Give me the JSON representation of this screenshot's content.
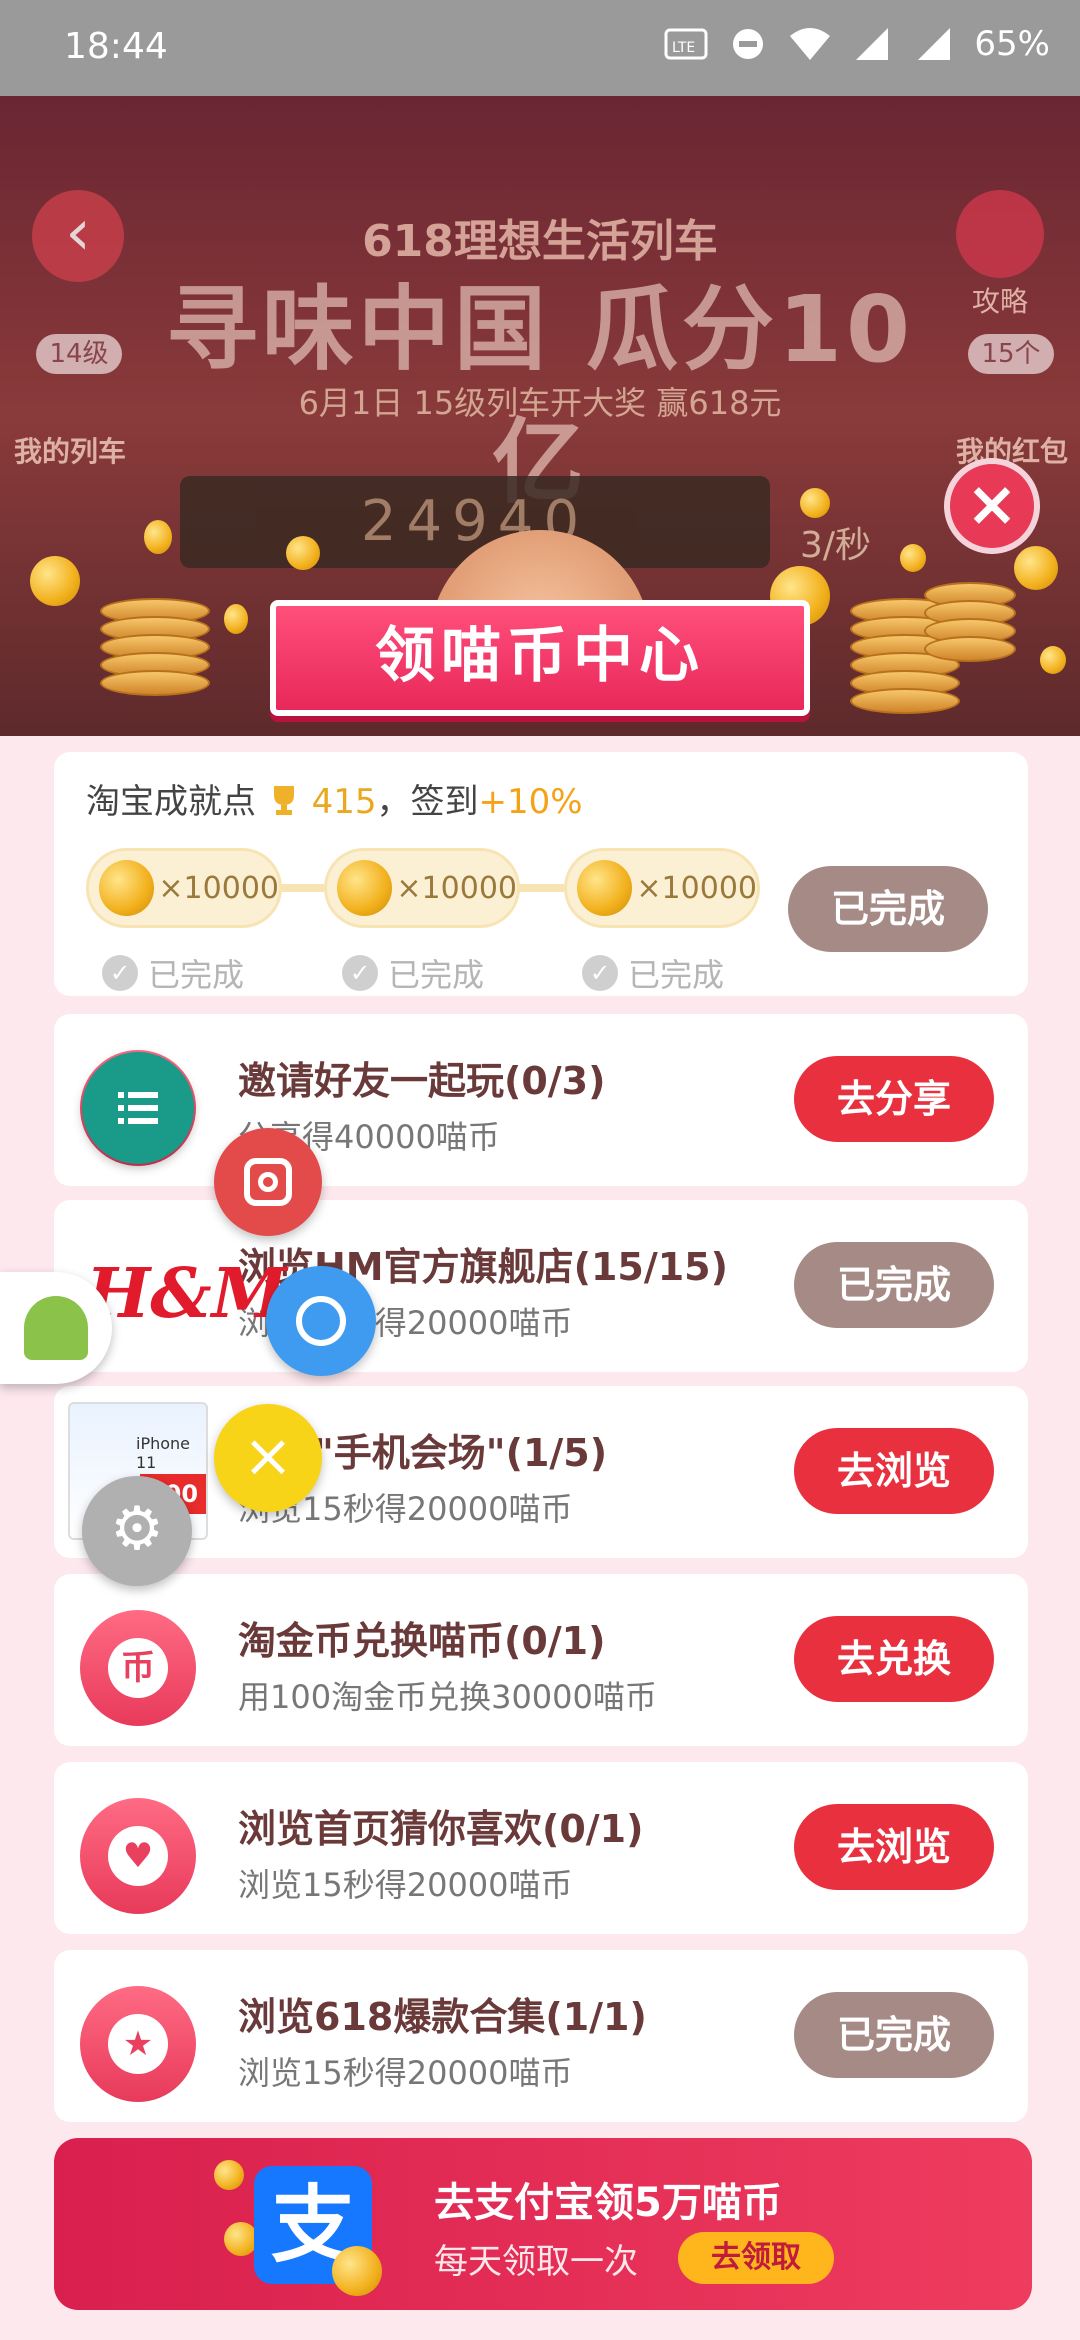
{
  "status_bar": {
    "time": "18:44",
    "battery": "65%",
    "icons": [
      "volte-icon",
      "dnd-icon",
      "wifi-icon",
      "signal-icon",
      "signal-icon"
    ]
  },
  "background": {
    "subtitle": "618理想生活列车",
    "headline": "寻味中国 瓜分10亿",
    "date_line": "6月1日 15级列车开大奖 赢618元",
    "strategy_label": "攻略",
    "level_badge": "14级",
    "count_badge": "15个",
    "my_train_label": "我的列车",
    "my_redpacket_label": "我的红包",
    "counter": "24940",
    "rate": "3/秒"
  },
  "panel": {
    "banner_title": "领喵币中心",
    "achievement": {
      "prefix": "淘宝成就点",
      "points": "415",
      "suffix": "，签到",
      "bonus": "+10%"
    },
    "rewards": [
      {
        "amount": "×10000",
        "status": "已完成"
      },
      {
        "amount": "×10000",
        "status": "已完成"
      },
      {
        "amount": "×10000",
        "status": "已完成"
      }
    ],
    "signin_button": "已完成",
    "tasks": [
      {
        "title": "邀请好友一起玩(0/3)",
        "desc": "分享得40000喵币",
        "button": "去分享",
        "icon": "share-icon"
      },
      {
        "title": "浏览HM官方旗舰店(15/15)",
        "desc": "浏览15秒得20000喵币",
        "button": "已完成",
        "icon": "hm-logo",
        "logo_text": "H&M"
      },
      {
        "title": "逛逛\"手机会场\"(1/5)",
        "desc": "浏览15秒得20000喵币",
        "button": "去浏览",
        "icon": "phone-promo-image",
        "image_text": {
          "model": "iPhone 11",
          "price": "300"
        }
      },
      {
        "title": "淘金币兑换喵币(0/1)",
        "desc": "用100淘金币兑换30000喵币",
        "button": "去兑换",
        "icon": "coin-exchange-icon",
        "icon_text": "币"
      },
      {
        "title": "浏览首页猜你喜欢(0/1)",
        "desc": "浏览15秒得20000喵币",
        "button": "去浏览",
        "icon": "heart-icon"
      },
      {
        "title": "浏览618爆款合集(1/1)",
        "desc": "浏览15秒得20000喵币",
        "button": "已完成",
        "icon": "star-icon"
      }
    ],
    "alipay": {
      "logo_text": "支",
      "title": "去支付宝领5万喵币",
      "subtitle": "每天领取一次",
      "button": "去领取"
    }
  },
  "colors": {
    "primary_red": "#e8303f",
    "done_gray": "#a58a86",
    "panel_pink": "#fde8ee",
    "gold": "#f2b01c"
  }
}
